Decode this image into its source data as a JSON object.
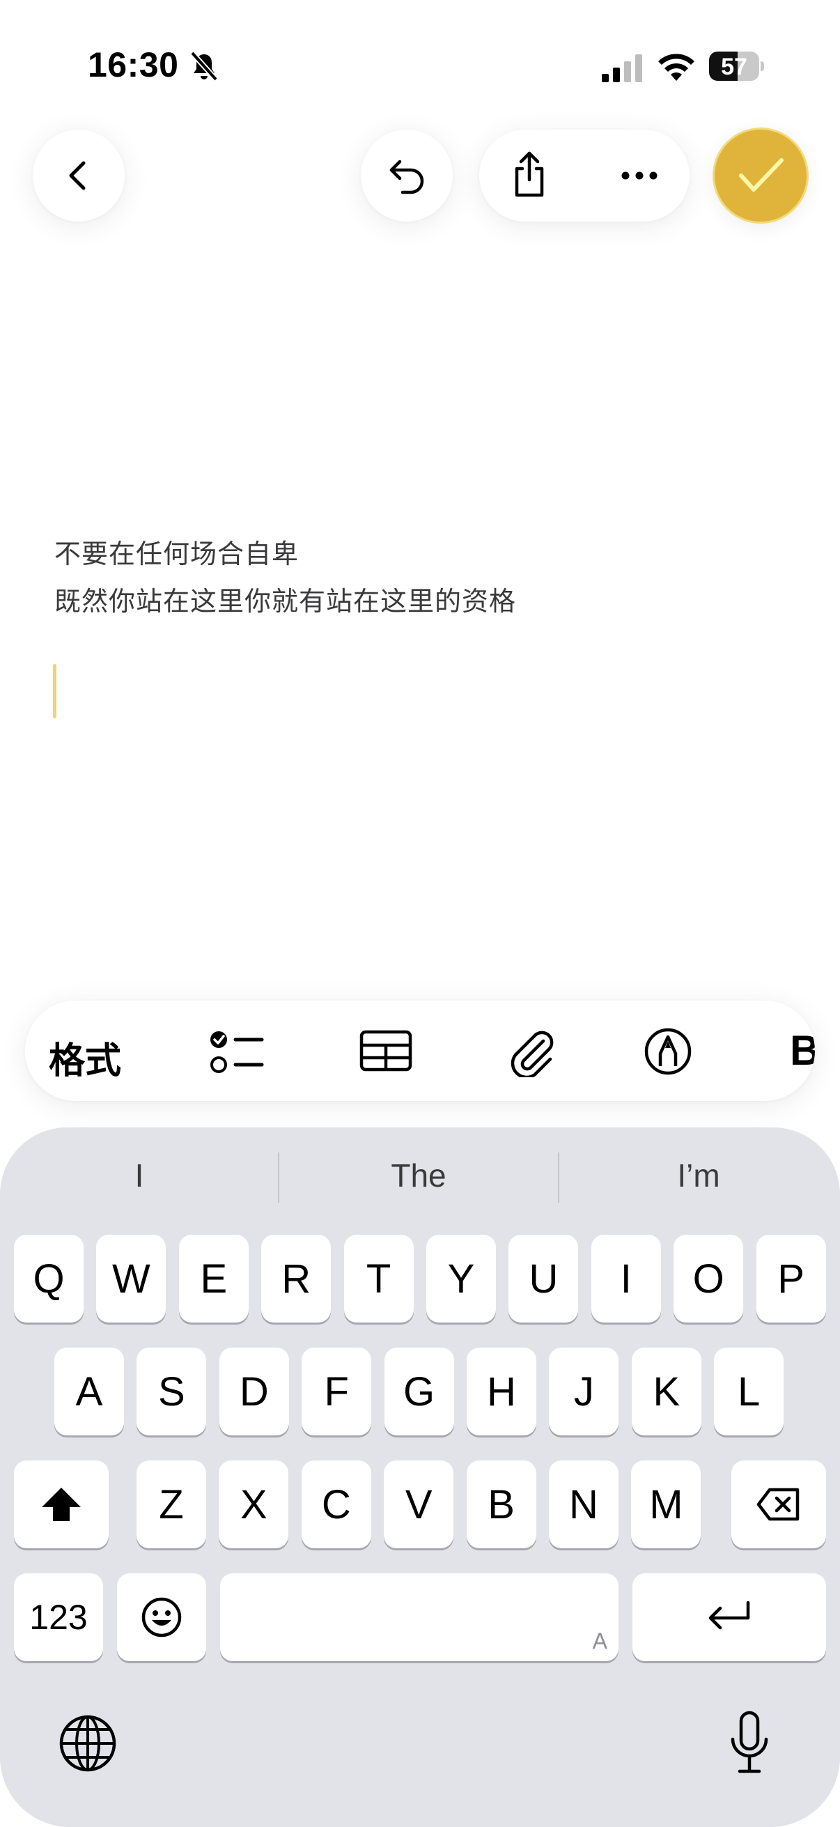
{
  "status_bar": {
    "time": "16:30",
    "battery_level": "57",
    "battery_fraction": 0.57
  },
  "toolbar": {
    "back_icon": "chevron-left-icon",
    "undo_icon": "undo-icon",
    "share_icon": "share-icon",
    "more_icon": "ellipsis-icon",
    "done_icon": "checkmark-icon",
    "accent_color": "#e0b43a"
  },
  "note": {
    "lines": [
      "不要在任何场合自卑",
      "既然你站在这里你就有站在这里的资格"
    ]
  },
  "format_bar": {
    "format_label": "格式",
    "icons": [
      "checklist-icon",
      "table-icon",
      "attachment-icon",
      "markup-icon",
      "text-style-icon"
    ]
  },
  "keyboard": {
    "suggestions": [
      "I",
      "The",
      "I’m"
    ],
    "row1": [
      "Q",
      "W",
      "E",
      "R",
      "T",
      "Y",
      "U",
      "I",
      "O",
      "P"
    ],
    "row2": [
      "A",
      "S",
      "D",
      "F",
      "G",
      "H",
      "J",
      "K",
      "L"
    ],
    "row3": [
      "Z",
      "X",
      "C",
      "V",
      "B",
      "N",
      "M"
    ],
    "numbers_label": "123",
    "space_hint": "A"
  }
}
